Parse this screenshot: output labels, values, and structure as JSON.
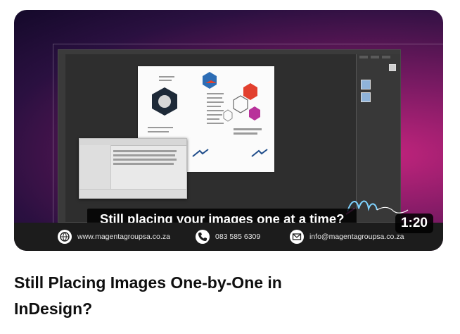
{
  "video": {
    "caption": "Still placing your images one at a time?",
    "duration": "1:20",
    "title": "Still Placing Images One-by-One in InDesign?",
    "contacts": {
      "website": "www.magentagroupsa.co.za",
      "phone": "083 585 6309",
      "email": "info@magentagroupsa.co.za"
    }
  },
  "colors": {
    "accent_magenta": "#c3247d",
    "background_dark": "#14092a",
    "hex_blue": "#2d6db5",
    "hex_red": "#e2402e",
    "hex_purple": "#b8329a"
  },
  "icons": {
    "website": "globe-icon",
    "phone": "phone-icon",
    "email": "mail-icon"
  }
}
